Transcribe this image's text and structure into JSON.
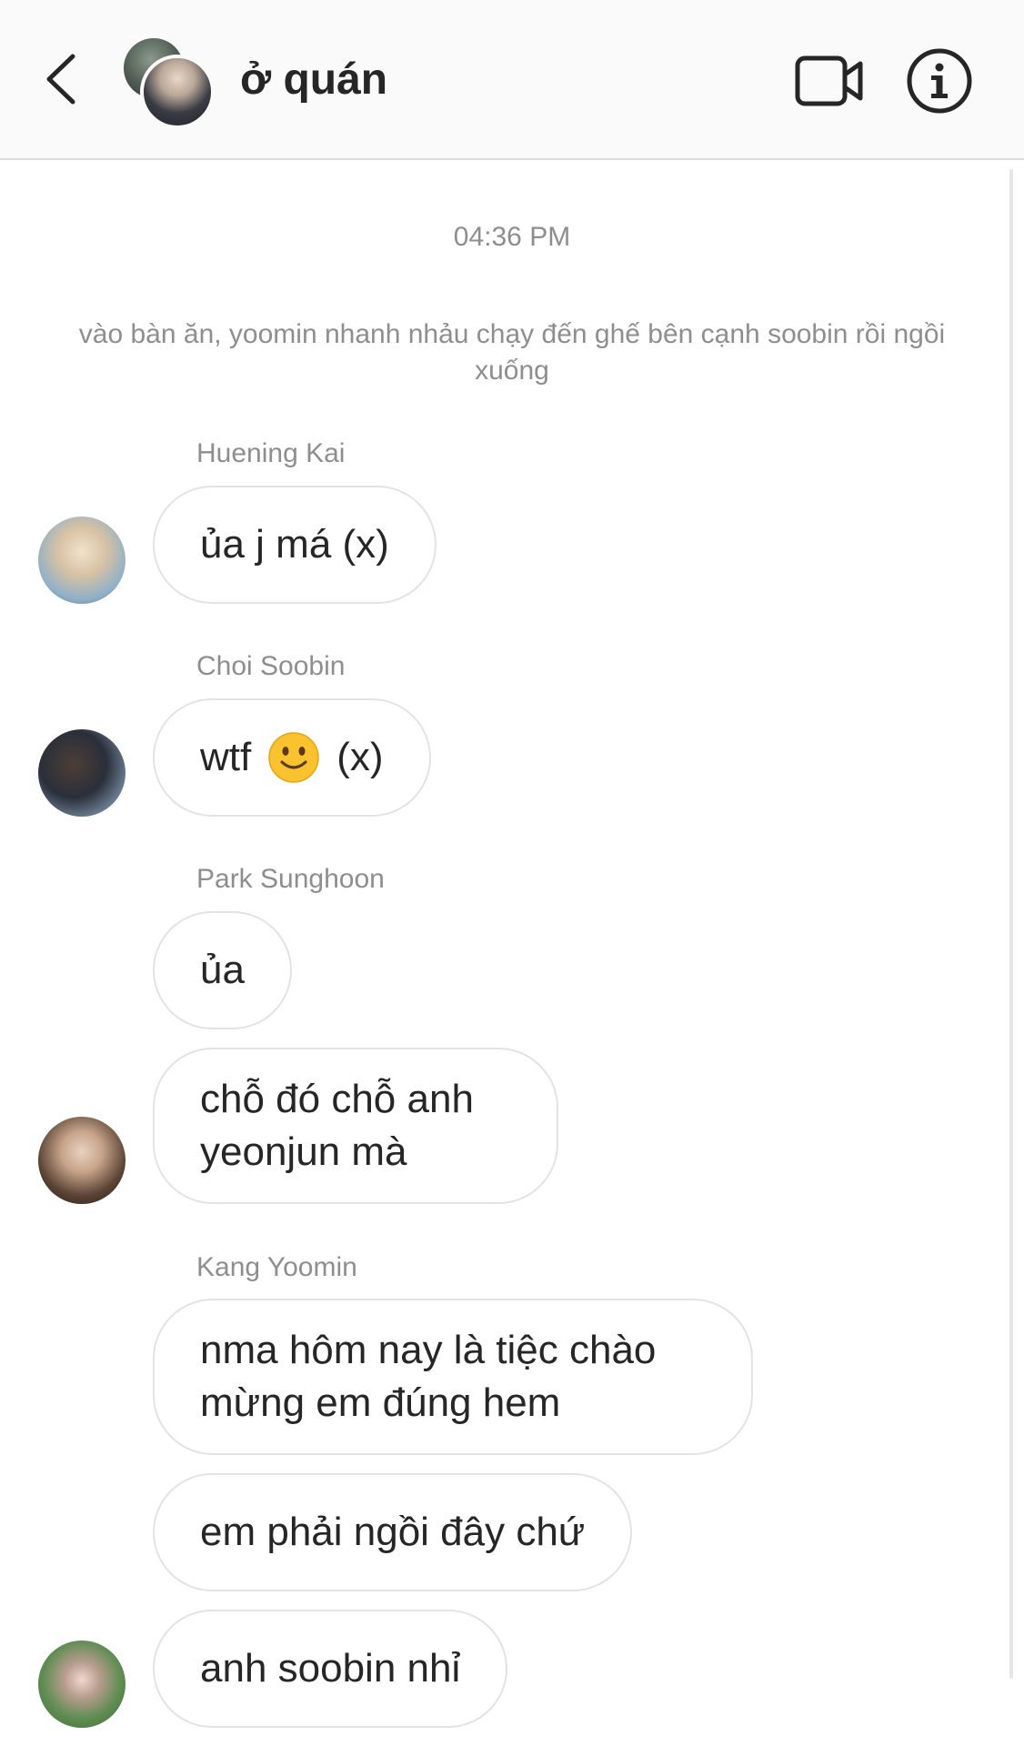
{
  "header": {
    "title": "ở quán",
    "back_icon": "chevron-left-icon",
    "video_icon": "video-camera-icon",
    "info_icon": "info-icon"
  },
  "timestamp": "04:36 PM",
  "narration": "vào bàn ăn, yoomin nhanh nhảu chạy đến ghế bên cạnh soobin rồi ngồi xuống",
  "messages": [
    {
      "sender": "Huening Kai",
      "text": "ủa j má (x)"
    },
    {
      "sender": "Choi Soobin",
      "text_before": "wtf",
      "emoji": "slightly-smiling-face-emoji",
      "text_after": "(x)"
    },
    {
      "sender": "Park Sunghoon",
      "bubbles": [
        "ủa",
        "chỗ đó chỗ anh yeonjun mà"
      ]
    },
    {
      "sender": "Kang Yoomin",
      "bubbles": [
        "nma hôm nay là tiệc chào mừng em đúng hem",
        "em phải ngồi đây chứ",
        "anh soobin nhỉ"
      ]
    }
  ],
  "colors": {
    "header_bg": "#fafafa",
    "secondary_text": "#8e8e8e",
    "bubble_border": "#e3e3e3",
    "text": "#262626"
  }
}
